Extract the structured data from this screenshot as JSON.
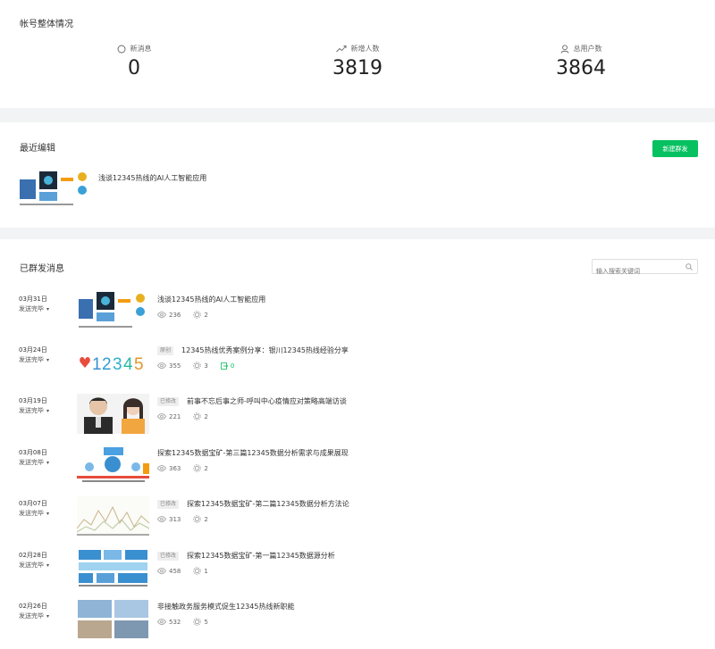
{
  "overview": {
    "title": "帐号整体情况",
    "stats": [
      {
        "label": "新消息",
        "value": "0",
        "icon": "message-icon"
      },
      {
        "label": "新增人数",
        "value": "3819",
        "icon": "trend-up-icon"
      },
      {
        "label": "总用户数",
        "value": "3864",
        "icon": "user-icon"
      }
    ]
  },
  "recent": {
    "title": "最近编辑",
    "new_button": "新建群发",
    "draft_title": "浅谈12345热线的AI人工智能应用"
  },
  "sent": {
    "title": "已群发消息",
    "search_placeholder": "输入搜索关键词",
    "accent": "#07c160",
    "messages": [
      {
        "date": "03月31日",
        "status": "发送完毕",
        "tag": "",
        "title": "浅谈12345热线的AI人工智能应用",
        "views": "236",
        "likes": "2",
        "shares": ""
      },
      {
        "date": "03月24日",
        "status": "发送完毕",
        "tag": "原创",
        "title": "12345热线优秀案例分享：银川12345热线经验分享",
        "views": "355",
        "likes": "3",
        "shares": "0"
      },
      {
        "date": "03月19日",
        "status": "发送完毕",
        "tag": "已修改",
        "title": "前事不忘后事之师-呼叫中心疫情应对策略高端访谈",
        "views": "221",
        "likes": "2",
        "shares": ""
      },
      {
        "date": "03月08日",
        "status": "发送完毕",
        "tag": "",
        "title": "探索12345数据宝矿-第三篇12345数据分析需求与成果展现",
        "views": "363",
        "likes": "2",
        "shares": ""
      },
      {
        "date": "03月07日",
        "status": "发送完毕",
        "tag": "已修改",
        "title": "探索12345数据宝矿-第二篇12345数据分析方法论",
        "views": "313",
        "likes": "2",
        "shares": ""
      },
      {
        "date": "02月28日",
        "status": "发送完毕",
        "tag": "已修改",
        "title": "探索12345数据宝矿-第一篇12345数据源分析",
        "views": "458",
        "likes": "1",
        "shares": ""
      },
      {
        "date": "02月26日",
        "status": "发送完毕",
        "tag": "",
        "title": "非接触政务服务模式促生12345热线新职能",
        "views": "532",
        "likes": "5",
        "shares": ""
      }
    ]
  }
}
